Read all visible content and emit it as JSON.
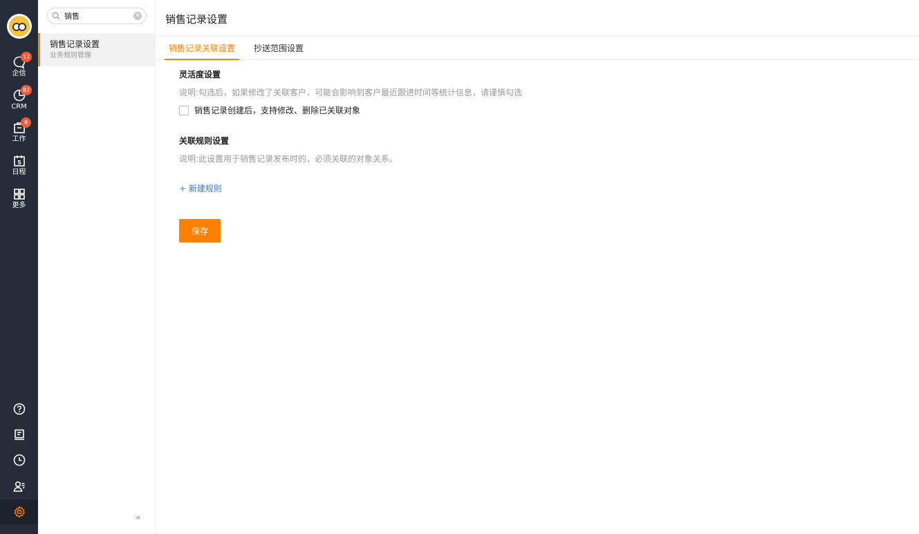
{
  "colors": {
    "accent": "#ff8000",
    "rail_bg": "#262c38",
    "badge": "#f35c3b",
    "link": "#3a7bd5"
  },
  "rail": {
    "items": [
      {
        "label": "企信",
        "icon": "chat-bubble-icon",
        "badge": "17"
      },
      {
        "label": "CRM",
        "icon": "pie-chart-icon",
        "badge": "87"
      },
      {
        "label": "工作",
        "icon": "briefcase-icon",
        "badge": "8"
      },
      {
        "label": "日程",
        "icon": "calendar-icon",
        "badge": "",
        "day": "5"
      },
      {
        "label": "更多",
        "icon": "grid-icon",
        "badge": ""
      }
    ],
    "bottom": [
      "help-icon",
      "announcement-icon",
      "clock-icon",
      "contacts-icon",
      "settings-icon"
    ]
  },
  "submenu": {
    "search": {
      "value": "销售",
      "placeholder": ""
    },
    "item": {
      "title": "销售记录设置",
      "subtitle": "业务规则管理"
    },
    "collapse_glyph": "«"
  },
  "main": {
    "title": "销售记录设置",
    "tabs": [
      {
        "label": "销售记录关联设置",
        "active": true
      },
      {
        "label": "抄送范围设置",
        "active": false
      }
    ],
    "flex_section": {
      "title": "灵活度设置",
      "desc": "说明:勾选后，如果修改了关联客户，可能会影响到客户最近跟进时间等统计信息，请谨慎勾选",
      "checkbox_label": "销售记录创建后，支持修改、删除已关联对象",
      "checked": false
    },
    "rule_section": {
      "title": "关联规则设置",
      "desc": "说明:此设置用于销售记录发布时的，必须关联的对象关系。",
      "add_label": "+ 新建规则"
    },
    "save_label": "保存"
  }
}
